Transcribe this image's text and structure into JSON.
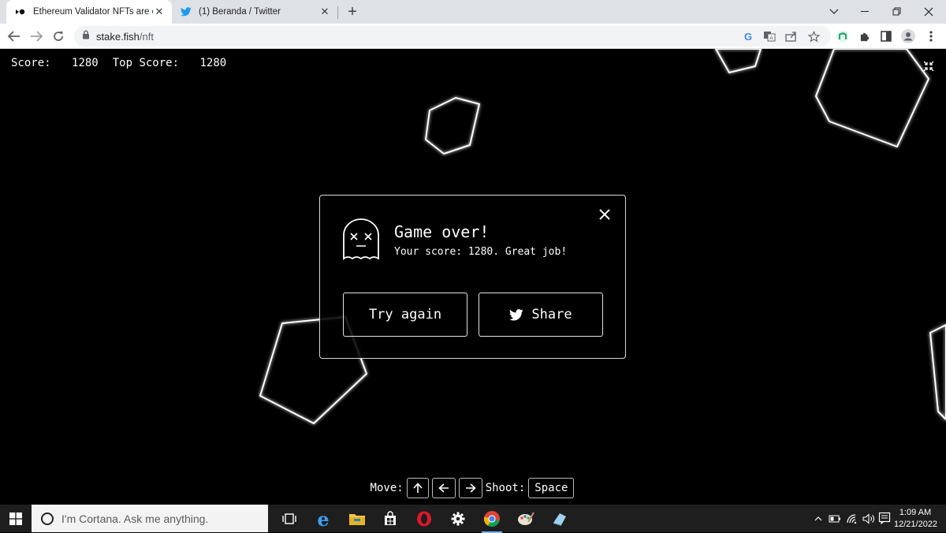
{
  "browser": {
    "tabs": [
      {
        "title": "Ethereum Validator NFTs are com",
        "active": true,
        "icon": "stakefish-logo-icon"
      },
      {
        "title": "(1) Beranda / Twitter",
        "active": false,
        "icon": "twitter-icon"
      }
    ],
    "url_host": "stake.fish",
    "url_path": "/nft"
  },
  "game": {
    "score_label": "Score:",
    "score_value": "1280",
    "top_score_label": "Top Score:",
    "top_score_value": "1280",
    "modal": {
      "title": "Game over!",
      "subtitle": "Your score: 1280. Great job!",
      "try_again": "Try again",
      "share": "Share"
    },
    "controls": {
      "move_label": "Move:",
      "shoot_label": "Shoot:",
      "space_key": "Space"
    }
  },
  "taskbar": {
    "search_placeholder": "I'm Cortana. Ask me anything.",
    "time": "1:09 AM",
    "date": "12/21/2022"
  },
  "colors": {
    "chrome_bg": "#dee1e6",
    "game_bg": "#000000",
    "taskbar_bg": "#1e1e1e",
    "twitter_blue": "#1d9bf0"
  }
}
